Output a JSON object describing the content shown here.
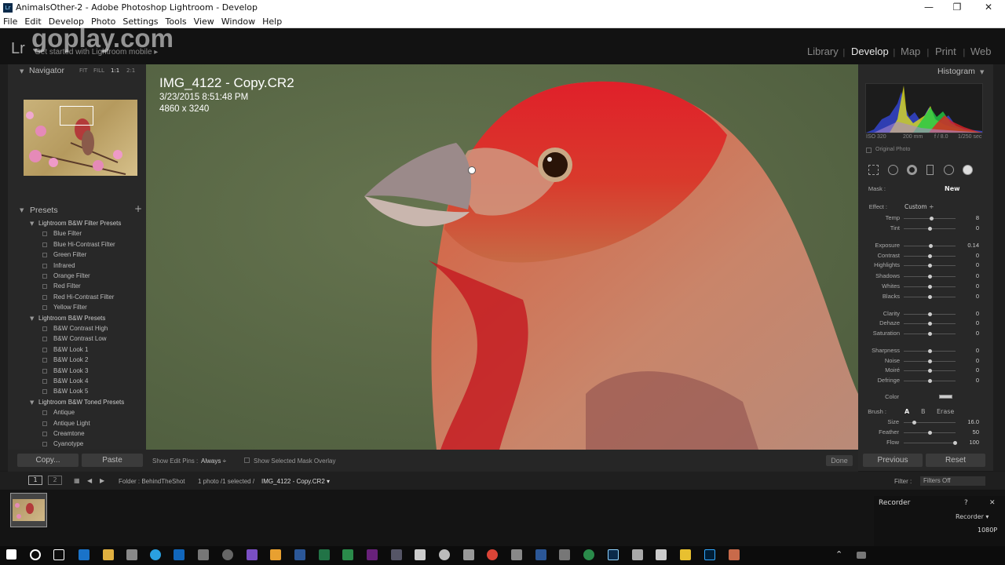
{
  "window": {
    "title": "AnimalsOther-2 - Adobe Photoshop Lightroom - Develop",
    "app_icon": "Lr",
    "controls": {
      "minimize": "—",
      "maximize": "❐",
      "close": "✕"
    }
  },
  "menu": [
    "File",
    "Edit",
    "Develop",
    "Photo",
    "Settings",
    "Tools",
    "View",
    "Window",
    "Help"
  ],
  "identity_plate": {
    "logo": "Lr",
    "watermark": "goplay.com",
    "subtitle": "Get started with Lightroom mobile ▸"
  },
  "modules": [
    {
      "label": "Library",
      "active": false
    },
    {
      "label": "Develop",
      "active": true
    },
    {
      "label": "Map",
      "active": false
    },
    {
      "label": "Print",
      "active": false
    },
    {
      "label": "Web",
      "active": false
    }
  ],
  "left_panel": {
    "navigator_title": "Navigator",
    "zoom_options": [
      "FIT",
      "FILL",
      "1:1",
      "2:1"
    ],
    "presets_title": "Presets",
    "presets_add": "+",
    "groups": [
      {
        "name": "Lightroom B&W Filter Presets",
        "items": [
          "Blue Filter",
          "Blue Hi-Contrast Filter",
          "Green Filter",
          "Infrared",
          "Orange Filter",
          "Red Filter",
          "Red Hi-Contrast Filter",
          "Yellow Filter"
        ]
      },
      {
        "name": "Lightroom B&W Presets",
        "items": [
          "B&W Contrast High",
          "B&W Contrast Low",
          "B&W Look 1",
          "B&W Look 2",
          "B&W Look 3",
          "B&W Look 4",
          "B&W Look 5"
        ]
      },
      {
        "name": "Lightroom B&W Toned Presets",
        "items": [
          "Antique",
          "Antique Light",
          "Creamtone",
          "Cyanotype"
        ]
      }
    ],
    "copy_button": "Copy...",
    "paste_button": "Paste"
  },
  "image_info": {
    "filename": "IMG_4122 - Copy.CR2",
    "datetime": "3/23/2015 8:51:48 PM",
    "dimensions": "4860 x 3240"
  },
  "toolbar": {
    "show_edit_pins_label": "Show Edit Pins :",
    "show_edit_pins_value": "Always ÷",
    "mask_overlay_label": "Show Selected Mask Overlay",
    "done_button": "Done"
  },
  "right_panel": {
    "histogram_title": "Histogram",
    "hist_meta": [
      "ISO 320",
      "200 mm",
      "f / 8.0",
      "1/250 sec"
    ],
    "original_photo_label": "Original Photo",
    "mask_label": "Mask :",
    "mask_new": "New",
    "effect_label": "Effect :",
    "effect_value": "Custom ÷",
    "sliders": [
      {
        "label": "Temp",
        "value": "8",
        "pos": 0.53
      },
      {
        "label": "Tint",
        "value": "0",
        "pos": 0.5
      },
      {
        "label": "Exposure",
        "value": "0.14",
        "pos": 0.52
      },
      {
        "label": "Contrast",
        "value": "0",
        "pos": 0.5
      },
      {
        "label": "Highlights",
        "value": "0",
        "pos": 0.5
      },
      {
        "label": "Shadows",
        "value": "0",
        "pos": 0.5
      },
      {
        "label": "Whites",
        "value": "0",
        "pos": 0.5
      },
      {
        "label": "Blacks",
        "value": "0",
        "pos": 0.5
      },
      {
        "label": "Clarity",
        "value": "0",
        "pos": 0.5
      },
      {
        "label": "Dehaze",
        "value": "0",
        "pos": 0.5
      },
      {
        "label": "Saturation",
        "value": "0",
        "pos": 0.5
      },
      {
        "label": "Sharpness",
        "value": "0",
        "pos": 0.5
      },
      {
        "label": "Noise",
        "value": "0",
        "pos": 0.5
      },
      {
        "label": "Moiré",
        "value": "0",
        "pos": 0.5
      },
      {
        "label": "Defringe",
        "value": "0",
        "pos": 0.5
      }
    ],
    "color_label": "Color",
    "brush_label": "Brush :",
    "brush_a": "A",
    "brush_b": "B",
    "brush_erase": "Erase",
    "brush_sliders": [
      {
        "label": "Size",
        "value": "16.0",
        "pos": 0.2
      },
      {
        "label": "Feather",
        "value": "50",
        "pos": 0.5
      },
      {
        "label": "Flow",
        "value": "100",
        "pos": 0.98
      }
    ],
    "previous_button": "Previous",
    "reset_button": "Reset"
  },
  "filmstrip": {
    "view_1": "1",
    "view_2": "2",
    "source": "Folder : BehindTheShot",
    "count": "1 photo /1 selected /",
    "current": "IMG_4122 - Copy.CR2 ▾",
    "filter_label": "Filter :",
    "filter_value": "Filters Off"
  },
  "recorder": {
    "title": "Recorder",
    "help": "?",
    "close": "✕",
    "dropdown": "Recorder ▾",
    "quality": "1080P"
  }
}
